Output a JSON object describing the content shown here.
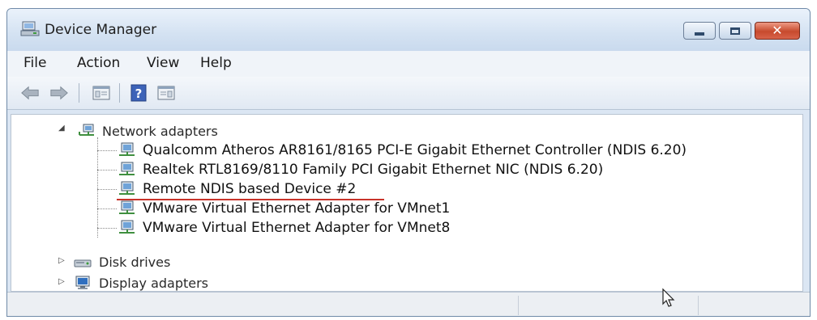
{
  "window": {
    "title": "Device Manager",
    "controls": {
      "minimize": "minimize",
      "maximize": "maximize",
      "close": "close"
    }
  },
  "menu": [
    "File",
    "Action",
    "View",
    "Help"
  ],
  "toolbar": {
    "buttons": [
      "back-arrow-icon",
      "forward-arrow-icon",
      "properties-icon",
      "help-icon",
      "scan-hardware-icon"
    ]
  },
  "tree": {
    "network_adapters": {
      "label": "Network adapters",
      "expanded": true,
      "children": [
        "Qualcomm Atheros AR8161/8165 PCI-E Gigabit Ethernet Controller (NDIS 6.20)",
        "Realtek RTL8169/8110 Family PCI Gigabit Ethernet NIC (NDIS 6.20)",
        "Remote NDIS based Device #2",
        "VMware Virtual Ethernet Adapter for VMnet1",
        "VMware Virtual Ethernet Adapter for VMnet8"
      ],
      "highlighted_index": 2,
      "highlight_color": "#c8332a"
    },
    "disk_drives": {
      "label": "Disk drives",
      "expanded": false
    },
    "display_adapters": {
      "label": "Display adapters",
      "expanded": false
    }
  },
  "colors": {
    "titlebar": "#d4e2f2",
    "close_button": "#c74a2d",
    "content_bg": "#ffffff"
  }
}
